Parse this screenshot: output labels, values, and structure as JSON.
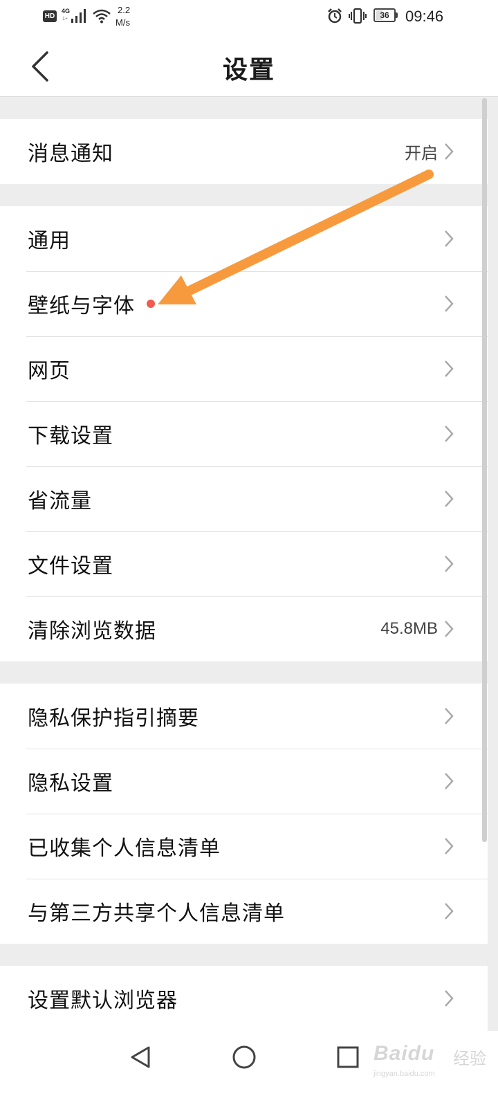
{
  "status_bar": {
    "hd": "HD",
    "network_type": "4G",
    "network_sub": "1+",
    "speed_value": "2.2",
    "speed_unit": "M/s",
    "battery": "36",
    "time": "09:46"
  },
  "header": {
    "title": "设置"
  },
  "groups": [
    {
      "items": [
        {
          "label": "消息通知",
          "value": "开启"
        }
      ]
    },
    {
      "items": [
        {
          "label": "通用",
          "value": ""
        },
        {
          "label": "壁纸与字体",
          "value": ""
        },
        {
          "label": "网页",
          "value": ""
        },
        {
          "label": "下载设置",
          "value": ""
        },
        {
          "label": "省流量",
          "value": ""
        },
        {
          "label": "文件设置",
          "value": ""
        },
        {
          "label": "清除浏览数据",
          "value": "45.8MB"
        }
      ]
    },
    {
      "items": [
        {
          "label": "隐私保护指引摘要",
          "value": ""
        },
        {
          "label": "隐私设置",
          "value": ""
        },
        {
          "label": "已收集个人信息清单",
          "value": ""
        },
        {
          "label": "与第三方共享个人信息清单",
          "value": ""
        }
      ]
    },
    {
      "items": [
        {
          "label": "设置默认浏览器",
          "value": ""
        }
      ]
    }
  ],
  "annotation": {
    "color": "#f79a3e",
    "dot_color": "#f05a50"
  },
  "watermark": {
    "brand": "Baidu",
    "name": "经验",
    "url": "jingyan.baidu.com"
  }
}
